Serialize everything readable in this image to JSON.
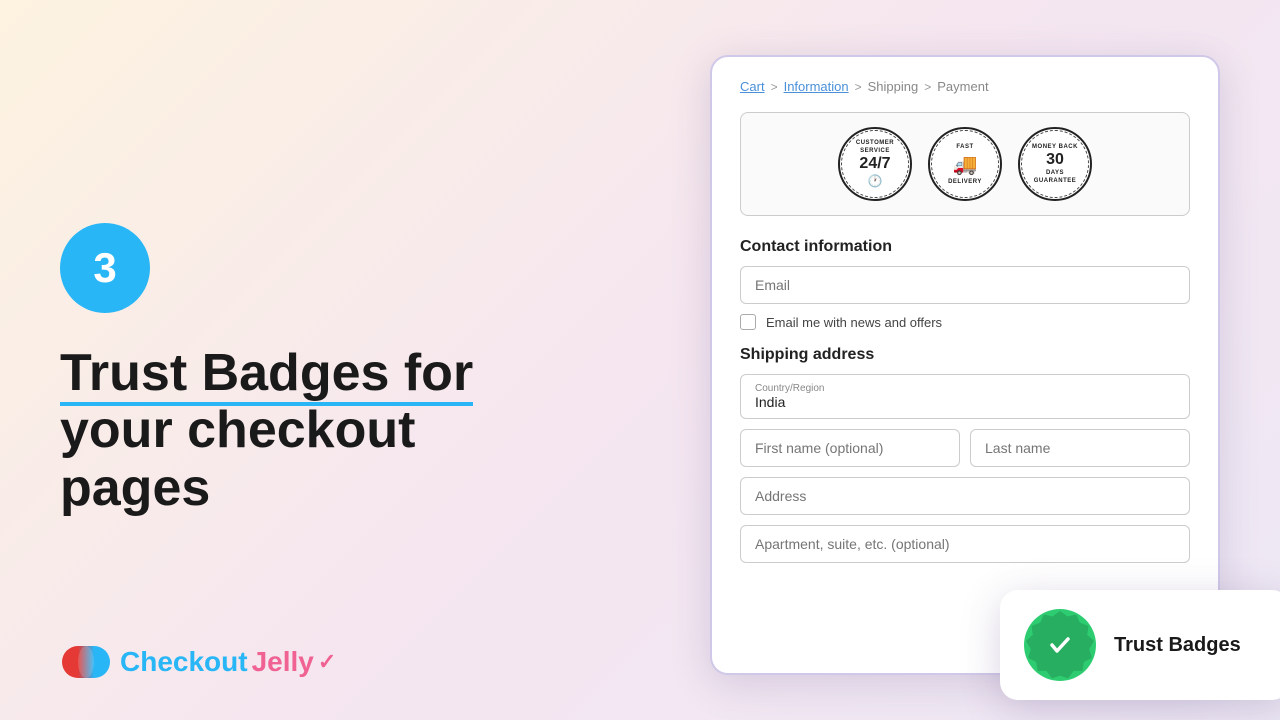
{
  "left": {
    "step_number": "3",
    "title_part1": "Trust Badges for",
    "title_part2": "your checkout",
    "title_part3": "pages"
  },
  "logo": {
    "checkout_text": "Checkout",
    "jelly_text": "Jelly",
    "mark": "✓"
  },
  "breadcrumb": {
    "cart": "Cart",
    "sep1": ">",
    "information": "Information",
    "sep2": ">",
    "shipping": "Shipping",
    "sep3": ">",
    "payment": "Payment"
  },
  "badges": [
    {
      "line1": "CUSTOMER",
      "line2": "SERVICE",
      "num": "24/7",
      "icon": "🕐"
    },
    {
      "line1": "FAST",
      "line2": "DELIVERY",
      "num": "🚚",
      "icon": ""
    },
    {
      "line1": "MONEY BACK",
      "line2": "GUARANTEE",
      "num": "30",
      "line3": "DAYS"
    }
  ],
  "form": {
    "contact_label": "Contact information",
    "email_placeholder": "Email",
    "newsletter_label": "Email me with news and offers",
    "shipping_label": "Shipping address",
    "country_label": "Country/Region",
    "country_value": "India",
    "first_name_placeholder": "First name (optional)",
    "last_name_placeholder": "Last name",
    "address_placeholder": "Address",
    "apt_placeholder": "Apartment, suite, etc. (optional)"
  },
  "trust_badge_card": {
    "label": "Trust Badges"
  }
}
